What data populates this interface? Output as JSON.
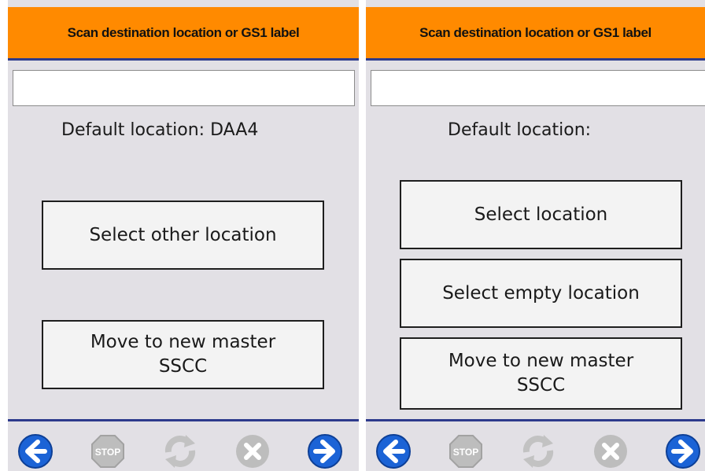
{
  "left_screen": {
    "header_title": "Scan destination location or GS1 label",
    "scan_input_value": "",
    "default_location_text": "Default location: DAA4",
    "buttons": {
      "select_other_location": "Select other location",
      "move_to_master_sscc": "Move to new master\nSSCC"
    }
  },
  "right_screen": {
    "header_title": "Scan destination location or GS1 label",
    "scan_input_value": "",
    "default_location_text": "Default location:",
    "buttons": {
      "select_location": "Select location",
      "select_empty_location": "Select empty location",
      "move_to_master_sscc": "Move to new master\nSSCC"
    }
  },
  "toolbar": {
    "icons": [
      "back-arrow-icon",
      "stop-icon",
      "refresh-icon",
      "cancel-icon",
      "forward-arrow-icon"
    ],
    "stop_label": "STOP"
  },
  "colors": {
    "header_bg": "#ff8a00",
    "accent_blue": "#1b63d6",
    "divider": "#2d3a8c",
    "disabled_gray": "#b9b9b9",
    "screen_bg": "#e2e0e5"
  }
}
